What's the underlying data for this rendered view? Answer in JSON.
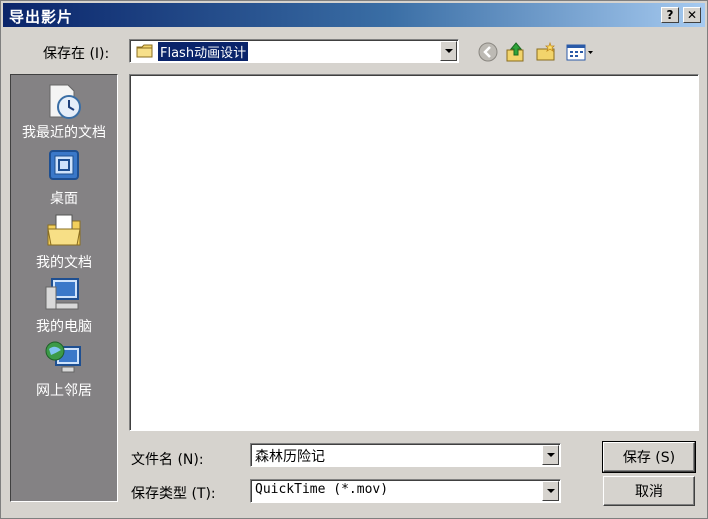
{
  "window": {
    "title": "导出影片",
    "help_glyph": "?",
    "close_glyph": "✕"
  },
  "save_in": {
    "label": "保存在 (I):",
    "value": "Flash动画设计"
  },
  "toolbar": {
    "icons": [
      "back-icon",
      "up-folder-icon",
      "new-folder-icon",
      "views-menu-icon"
    ]
  },
  "places": [
    {
      "label": "我最近的文档",
      "icon": "recent-documents-icon"
    },
    {
      "label": "桌面",
      "icon": "desktop-icon"
    },
    {
      "label": "我的文档",
      "icon": "my-documents-icon"
    },
    {
      "label": "我的电脑",
      "icon": "my-computer-icon"
    },
    {
      "label": "网上邻居",
      "icon": "network-places-icon"
    }
  ],
  "file_name": {
    "label": "文件名 (N):",
    "value": "森林历险记"
  },
  "save_type": {
    "label": "保存类型 (T):",
    "value": "QuickTime (*.mov)"
  },
  "buttons": {
    "save": "保存 (S)",
    "cancel": "取消"
  },
  "colors": {
    "titlebar_start": "#0a246a",
    "titlebar_end": "#a6caf0",
    "selection": "#0a246a",
    "places_bar": "#848284"
  }
}
